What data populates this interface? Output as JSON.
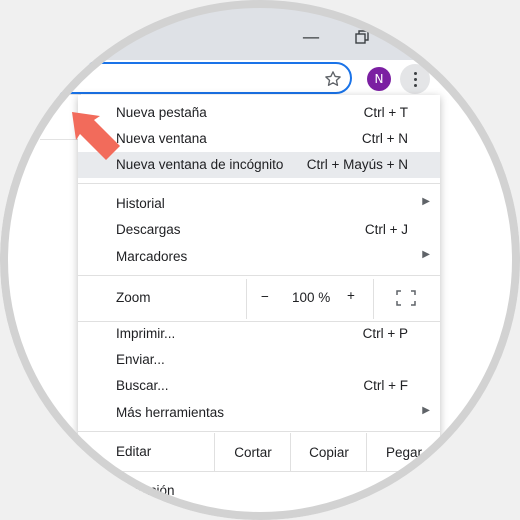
{
  "window": {
    "minimize_icon": "minimize-icon",
    "restore_icon": "restore-icon"
  },
  "toolbar": {
    "star_icon": "star-icon",
    "avatar_initial": "N",
    "menu_icon": "kebab-menu-icon",
    "avatar_color": "#7b1fa2"
  },
  "menu": {
    "items_top": [
      {
        "label": "Nueva pestaña",
        "shortcut": "Ctrl + T"
      },
      {
        "label": "Nueva ventana",
        "shortcut": "Ctrl + N"
      },
      {
        "label": "Nueva ventana de incógnito",
        "shortcut": "Ctrl + Mayús + N",
        "highlighted": true
      }
    ],
    "items_mid": [
      {
        "label": "Historial",
        "submenu": true
      },
      {
        "label": "Descargas",
        "shortcut": "Ctrl + J"
      },
      {
        "label": "Marcadores",
        "submenu": true
      }
    ],
    "zoom": {
      "label": "Zoom",
      "minus": "−",
      "value": "100 %",
      "plus": "+"
    },
    "items_tools": [
      {
        "label": "Imprimir...",
        "shortcut": "Ctrl + P"
      },
      {
        "label": "Enviar..."
      },
      {
        "label": "Buscar...",
        "shortcut": "Ctrl + F"
      },
      {
        "label": "Más herramientas",
        "submenu": true
      }
    ],
    "edit": {
      "label": "Editar",
      "cut": "Cortar",
      "copy": "Copiar",
      "paste": "Pegar"
    },
    "partial_item": "figuración"
  },
  "annotation": {
    "arrow_color": "#f26b5b"
  }
}
